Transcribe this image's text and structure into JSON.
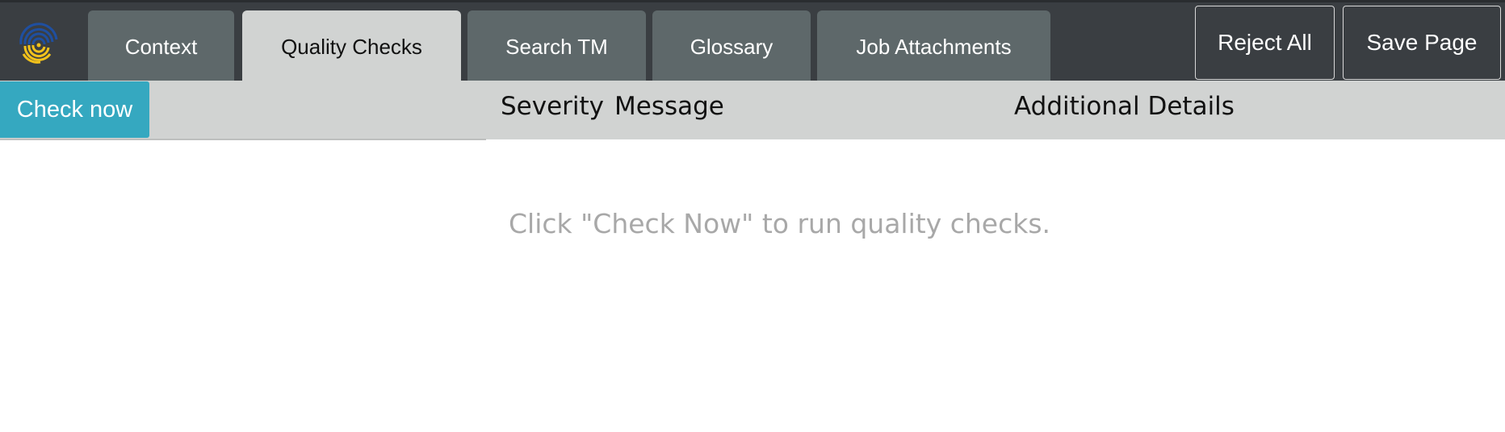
{
  "tabs": [
    {
      "label": "Context",
      "active": false
    },
    {
      "label": "Quality Checks",
      "active": true
    },
    {
      "label": "Search TM",
      "active": false
    },
    {
      "label": "Glossary",
      "active": false
    },
    {
      "label": "Job Attachments",
      "active": false
    }
  ],
  "actions": {
    "reject_all": "Reject All",
    "save_page": "Save Page"
  },
  "toolbar": {
    "check_now": "Check now"
  },
  "columns": {
    "severity": "Severity",
    "message": "Message",
    "additional_details": "Additional Details"
  },
  "empty_state": "Click \"Check Now\" to run quality checks.",
  "colors": {
    "topbar": "#3a3e42",
    "tab": "#5e686a",
    "active_tab": "#d1d3d2",
    "accent": "#35a8c0",
    "logo_blue": "#1f4fa0",
    "logo_yellow": "#f2c21b"
  }
}
